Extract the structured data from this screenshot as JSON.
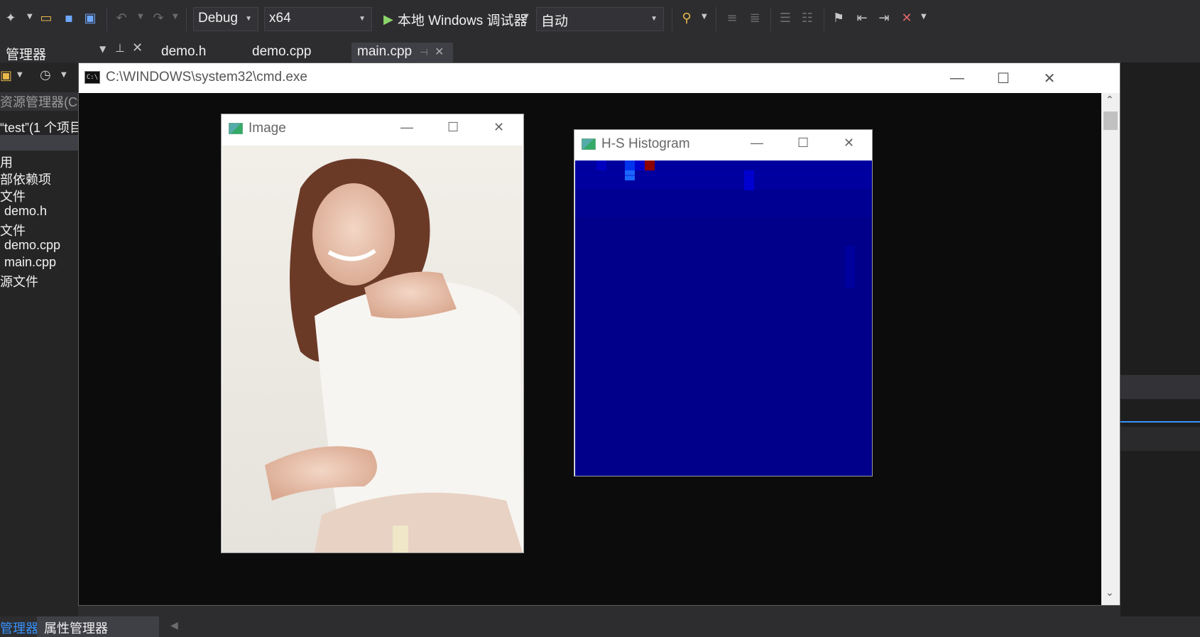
{
  "toolbar": {
    "config": "Debug",
    "platform": "x64",
    "debugger": "本地 Windows 调试器",
    "solution_config": "自动"
  },
  "tabs": [
    "demo.h",
    "demo.cpp",
    "main.cpp"
  ],
  "solution_explorer": {
    "title": "管理器",
    "search": "资源管理器(Ct",
    "solution": "“test”(1 个项目",
    "items": [
      "用",
      "部依赖项",
      "文件",
      "demo.h",
      "文件",
      "demo.cpp",
      "main.cpp",
      "源文件"
    ]
  },
  "status_tabs": [
    "管理器",
    "属性管理器"
  ],
  "cmd": {
    "title": "C:\\WINDOWS\\system32\\cmd.exe"
  },
  "image_window": {
    "title": "Image"
  },
  "histogram_window": {
    "title": "H-S Histogram"
  },
  "colors": {
    "accent": "#3794ff",
    "histogram_bg": "#00008b",
    "hot_bin": "#8b0000"
  }
}
